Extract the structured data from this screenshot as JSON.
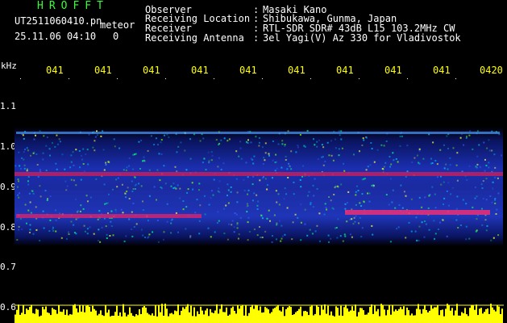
{
  "header": {
    "app_logo": "HROFFT",
    "file_name": "UT2511060410.pn",
    "meteor_label": "meteor",
    "datetime": "25.11.06 04:10",
    "counter": "0",
    "observer_label": "Observer",
    "observer_sep": ":",
    "observer_value": "Masaki Kano",
    "location_label": "Receiving Location",
    "location_sep": ":",
    "location_value": "Shibukawa, Gunma, Japan",
    "receiver_label": "Receiver",
    "receiver_sep": ":",
    "receiver_value": "RTL-SDR SDR# 43dB L15 103.2MHz CW",
    "antenna_label": "Receiving Antenna",
    "antenna_sep": ":",
    "antenna_value": "3el Yagi(V) Az 330 for Vladivostok"
  },
  "spectrogram": {
    "unit_label": "kHz",
    "time_ticks": [
      "041",
      "041",
      "041",
      "041",
      "041",
      "041",
      "041",
      "041",
      "041",
      "0420"
    ],
    "freq_ticks": [
      "1.1",
      "1.0",
      "0.9",
      "0.8",
      "0.7",
      "0.6"
    ],
    "colors": {
      "background": "#000000",
      "label": "#ffff00",
      "logo": "#33ff33"
    }
  }
}
